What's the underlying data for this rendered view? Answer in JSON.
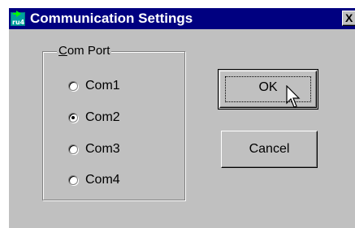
{
  "window": {
    "title": "Communication Settings",
    "close_label": "X",
    "app_icon": "app-icon"
  },
  "group": {
    "label_mnemonic": "C",
    "label_rest": "om Port",
    "options": [
      {
        "label": "Com1",
        "checked": false
      },
      {
        "label": "Com2",
        "checked": true
      },
      {
        "label": "Com3",
        "checked": false
      },
      {
        "label": "Com4",
        "checked": false
      }
    ]
  },
  "buttons": {
    "ok_label": "OK",
    "cancel_label": "Cancel"
  },
  "colors": {
    "titlebar": "#000080",
    "face": "#c0c0c0"
  }
}
